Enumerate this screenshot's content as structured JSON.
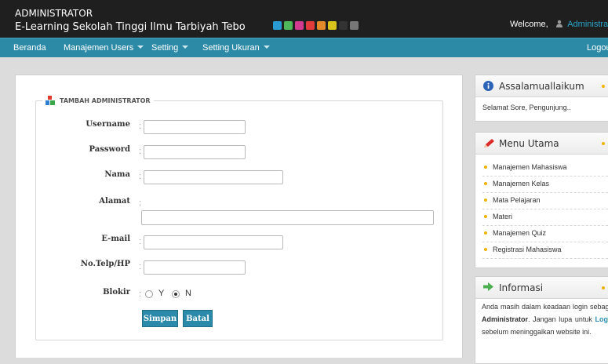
{
  "header": {
    "title": "ADMINISTRATOR",
    "subtitle": "E-Learning Sekolah Tinggi Ilmu Tarbiyah Tebo",
    "swatches": [
      "#2a9bd2",
      "#4fb65a",
      "#d23a8f",
      "#e13b3b",
      "#e38a2a",
      "#d9c41d",
      "#333333",
      "#777777"
    ],
    "welcome": "Welcome,",
    "user": "Administrator"
  },
  "nav": {
    "beranda": "Beranda",
    "users": "Manajemen Users",
    "setting": "Setting",
    "ukuran": "Setting Ukuran",
    "logout": "Logout"
  },
  "form": {
    "legend": "TAMBAH ADMINISTRATOR",
    "username_label": "Username",
    "password_label": "Password",
    "nama_label": "Nama",
    "alamat_label": "Alamat",
    "email_label": "E-mail",
    "telp_label": "No.Telp/HP",
    "blokir_label": "Blokir",
    "colon": ":",
    "username_value": "",
    "password_value": "",
    "nama_value": "",
    "alamat_value": "",
    "email_value": "",
    "telp_value": "",
    "opt_y": "Y",
    "opt_n": "N",
    "selected": "N",
    "save": "Simpan",
    "cancel": "Batal"
  },
  "sidebar": {
    "greeting_title": "Assalamuallaikum",
    "greeting_text": "Selamat Sore, Pengunjung..",
    "menu_title": "Menu Utama",
    "menu_items": [
      "Manajemen Mahasiswa",
      "Manajemen Kelas",
      "Mata Pelajaran",
      "Materi",
      "Manajemen Quiz",
      "Registrasi Mahasiswa"
    ],
    "info_title": "Informasi",
    "info_p1": "Anda masih dalam keadaan login sebagai :",
    "info_role": "Administrator",
    "info_p2": "Jangan lupa untuk",
    "info_logout": "Logout",
    "info_p3": "sebelum meninggalkan website ini."
  }
}
